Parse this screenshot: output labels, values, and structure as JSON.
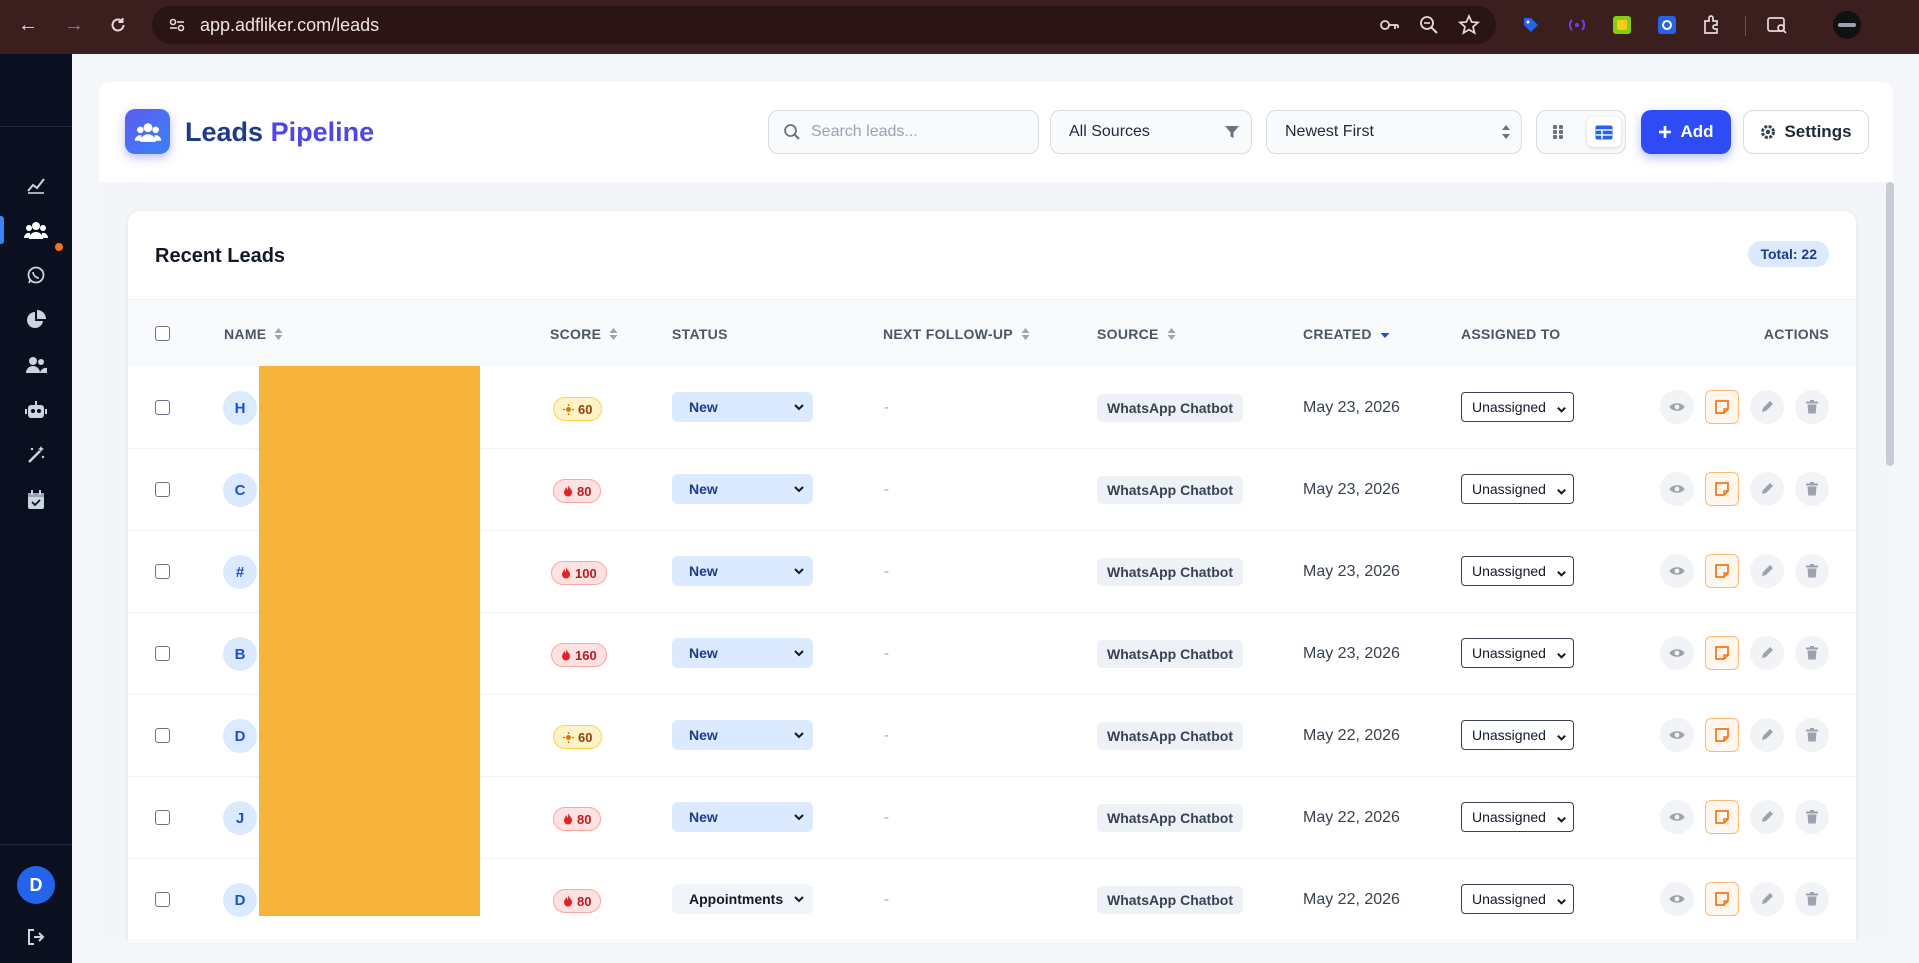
{
  "browser": {
    "url": "app.adfliker.com/leads"
  },
  "header": {
    "title_part1": "Leads",
    "title_part2": "Pipeline",
    "search_placeholder": "Search leads...",
    "source_filter": "All Sources",
    "sort_select": "Newest First",
    "add_label": "Add",
    "settings_label": "Settings"
  },
  "sidebar": {
    "user_initial": "D",
    "items": [
      "analytics-icon",
      "leads-icon",
      "whatsapp-icon",
      "reports-icon",
      "contacts-icon",
      "bot-icon",
      "magic-icon",
      "calendar-icon"
    ]
  },
  "card": {
    "title": "Recent Leads",
    "total": "Total: 22"
  },
  "table": {
    "columns": {
      "name": "NAME",
      "score": "SCORE",
      "status": "STATUS",
      "next_follow_up": "NEXT FOLLOW-UP",
      "source": "SOURCE",
      "created": "CREATED",
      "assigned_to": "ASSIGNED TO",
      "actions": "ACTIONS"
    },
    "rows": [
      {
        "initial": "H",
        "score": "60",
        "score_level": "warm",
        "status": "New",
        "follow_up": "-",
        "source": "WhatsApp Chatbot",
        "created": "May 23, 2026",
        "assigned": "Unassigned"
      },
      {
        "initial": "C",
        "score": "80",
        "score_level": "hot",
        "status": "New",
        "follow_up": "-",
        "source": "WhatsApp Chatbot",
        "created": "May 23, 2026",
        "assigned": "Unassigned"
      },
      {
        "initial": "#",
        "score": "100",
        "score_level": "hot",
        "status": "New",
        "follow_up": "-",
        "source": "WhatsApp Chatbot",
        "created": "May 23, 2026",
        "assigned": "Unassigned"
      },
      {
        "initial": "B",
        "score": "160",
        "score_level": "hot",
        "status": "New",
        "follow_up": "-",
        "source": "WhatsApp Chatbot",
        "created": "May 23, 2026",
        "assigned": "Unassigned"
      },
      {
        "initial": "D",
        "score": "60",
        "score_level": "warm",
        "status": "New",
        "follow_up": "-",
        "source": "WhatsApp Chatbot",
        "created": "May 22, 2026",
        "assigned": "Unassigned"
      },
      {
        "initial": "J",
        "score": "80",
        "score_level": "hot",
        "status": "New",
        "follow_up": "-",
        "source": "WhatsApp Chatbot",
        "created": "May 22, 2026",
        "assigned": "Unassigned"
      },
      {
        "initial": "D",
        "score": "80",
        "score_level": "hot",
        "status": "Appointments",
        "follow_up": "-",
        "source": "WhatsApp Chatbot",
        "created": "May 22, 2026",
        "assigned": "Unassigned"
      }
    ]
  },
  "colors": {
    "accent": "#2f4bf5",
    "sidebar_bg": "#0b1020",
    "browser_bg": "#3b1f1f",
    "redaction": "#f7b43a"
  }
}
